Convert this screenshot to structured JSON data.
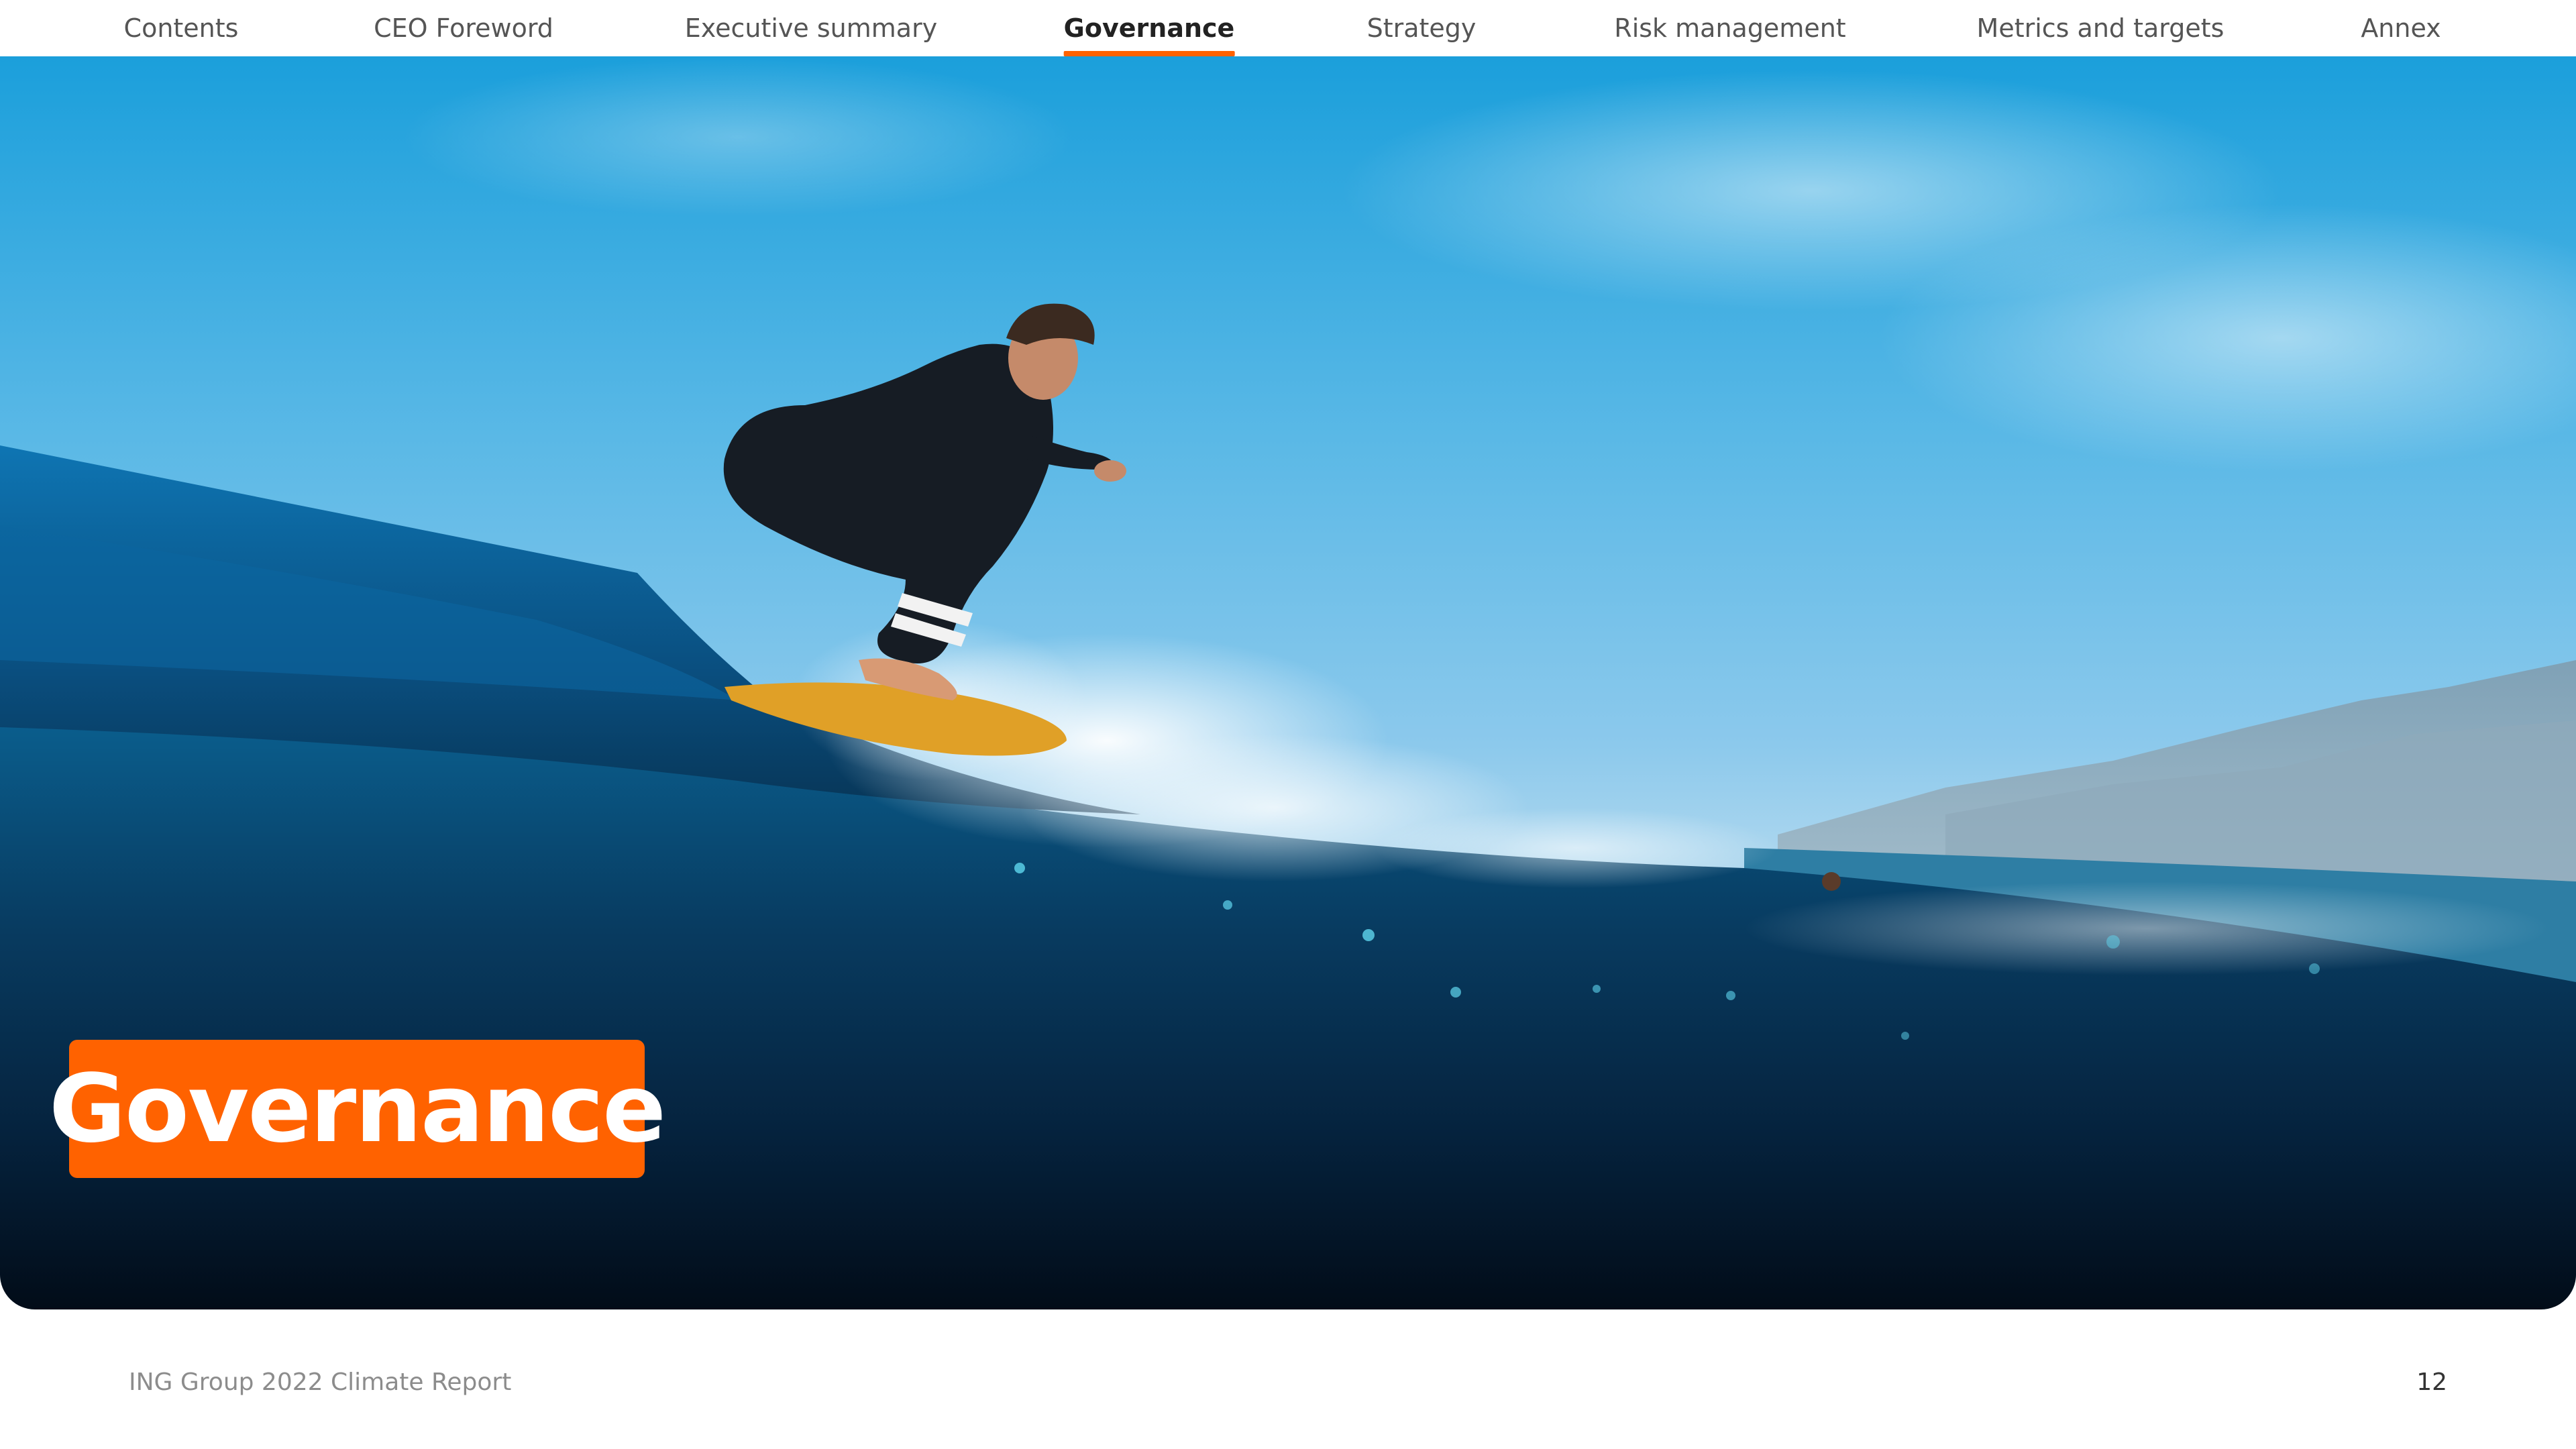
{
  "nav": {
    "items": [
      {
        "label": "Contents"
      },
      {
        "label": "CEO Foreword"
      },
      {
        "label": "Executive summary"
      },
      {
        "label": "Governance"
      },
      {
        "label": "Strategy"
      },
      {
        "label": "Risk management"
      },
      {
        "label": "Metrics and targets"
      },
      {
        "label": "Annex"
      }
    ],
    "active": "Governance"
  },
  "hero": {
    "section_title": "Governance",
    "image": "surfer-riding-wave-photo"
  },
  "footer": {
    "report_title": "ING Group 2022 Climate Report",
    "page_number": "12"
  },
  "colors": {
    "accent": "#ff6200",
    "nav_text": "#555555",
    "nav_active": "#222222",
    "footer_text": "#8c8c8c",
    "sky": "#59b8e6",
    "ocean_deep": "#041a2d"
  }
}
